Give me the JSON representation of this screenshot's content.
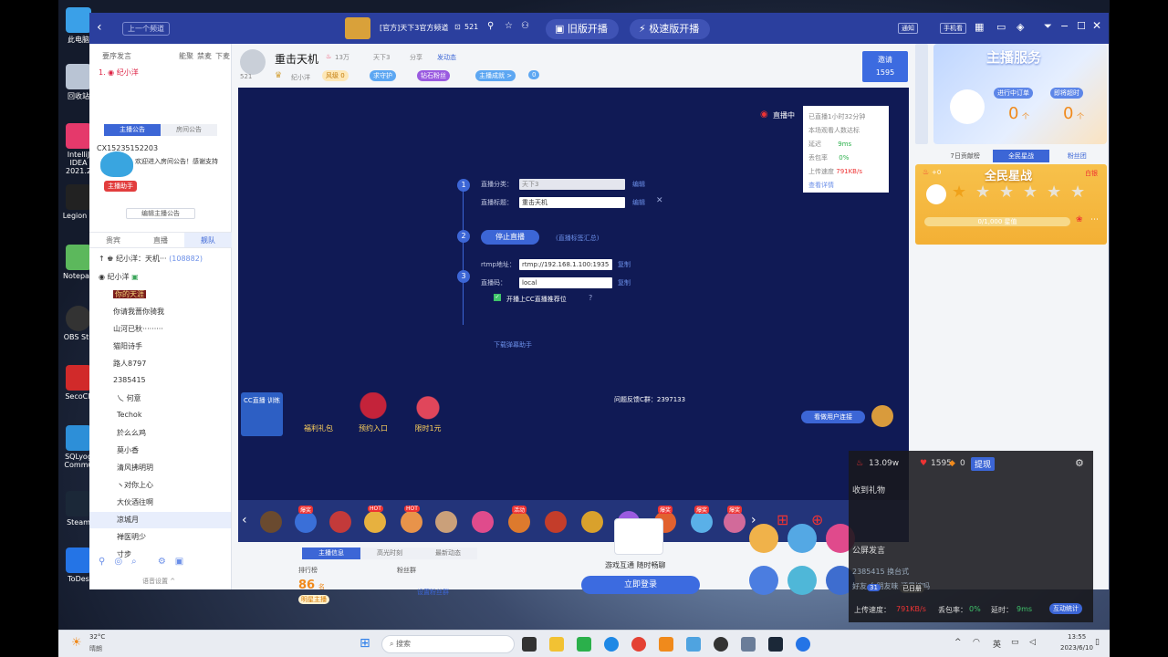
{
  "desktop": {
    "icons": [
      "此电脑",
      "回收站",
      "IntelliJ IDEA 2021.2",
      "Legion Z",
      "Notepad",
      "OBS Stu",
      "SecoCli",
      "SQLyog Commu",
      "Steam",
      "ToDes"
    ]
  },
  "titlebar": {
    "back_label": "上一个频道",
    "channel_title": "[官方]天下3官方频道",
    "viewer_count": "521",
    "old_stream_btn": "旧版开播",
    "fast_stream_btn": "极速版开播",
    "notify_btn": "通知",
    "phone_btn": "手机看"
  },
  "streamer": {
    "name": "重击天机",
    "heat": "13万",
    "game": "天下3",
    "share": "分享",
    "follow": "发动态",
    "id": "521",
    "tag_level": "风级 0",
    "tag_guard": "求守护",
    "tag_fans": "钻石粉丝",
    "tag_achievement": "主播成就 >",
    "tag_zero": "0",
    "sub_name": "纪小洋",
    "invite_label": "邀请",
    "invite_count": "1595"
  },
  "left_panel": {
    "tabs": [
      "要序发言",
      "能聚",
      "禁麦",
      "下麦"
    ],
    "user_first": "纪小洋",
    "announce_tabs": [
      "主播公告",
      "房间公告"
    ],
    "announce_id": "CX15235152203",
    "announce_text": "欢迎进入房间公告！感谢支持",
    "assistant_badge": "主播助手",
    "edit_btn": "编辑主播公告",
    "list_tabs": [
      "贵宾",
      "直播",
      "舰队"
    ],
    "top_user": "纪小洋：天机···",
    "top_user_id": "(108882)",
    "users": [
      "纪小洋",
      "你的天涯",
      "你请我蔷你骑我",
      "山河已秋·········",
      "猫阳诗手",
      "路人8797",
      "2385415",
      "乀 何意",
      "Techok",
      "於么么鸡",
      "莫小香",
      "清风拂明玥",
      "ヽ对你上心",
      "大伙酒往啊",
      "凉城月",
      "禅医明少",
      "寸步"
    ],
    "bottom_label": "语音设置 ^"
  },
  "stream_setup": {
    "live_status": "直播中",
    "stats": {
      "duration": "已直播1小时32分钟",
      "viewers": "本场观看人数达标",
      "delay_label": "延迟",
      "delay": "9ms",
      "loss_label": "丢包率",
      "loss": "0%",
      "upload_label": "上传速度",
      "upload": "791KB/s",
      "detail": "查看详情"
    },
    "category_label": "直播分类：",
    "category_value": "天下3",
    "category_edit": "编辑",
    "title_label": "直播标题：",
    "title_value": "重击天机",
    "title_edit": "编辑",
    "stop_btn": "停止直播",
    "rehearse_link": "(直播标签汇总)",
    "rtmp_label": "rtmp地址：",
    "rtmp_value": "rtmp://192.168.1.100:1935",
    "rtmp_copy": "复制",
    "key_label": "直播码：",
    "key_value": "local",
    "key_copy": "复制",
    "recommend_label": "开播上CC直播推荐位",
    "download_link": "下载弹幕助手",
    "feedback": "问题反馈C群：2397133",
    "banners": [
      "CC直播 训练",
      "福利礼包",
      "预约入口",
      "限时1元"
    ],
    "audience_btn": "看做用户连接"
  },
  "gift_bar": {
    "badges": [
      "爆奖",
      "HOT",
      "HOT",
      "活动",
      "爆奖",
      "爆奖",
      "爆奖"
    ]
  },
  "bottom_center": {
    "tabs": [
      "主播信息",
      "高光时刻",
      "最新动态"
    ],
    "rank_label": "排行榜",
    "fans_label": "粉丝群",
    "rank_value": "86",
    "rank_unit": "名",
    "rank_badge": "明星主播",
    "fans_setting": "设置粉丝群",
    "promo_text": "游戏互通 随时畅聊",
    "login_btn": "立即登录"
  },
  "right_panel": {
    "service_title": "主播服务",
    "in_progress": "进行中订单",
    "about_timeout": "即将超时",
    "count_a": "0",
    "count_b": "0",
    "unit": "个",
    "rank_tabs": [
      "7日贡献榜",
      "全民星战",
      "粉丝团"
    ],
    "war_title": "全民星战",
    "war_fire": "+0",
    "war_points": "0/1,000 星值",
    "war_tag": "白银"
  },
  "popup": {
    "hot": "13.09w",
    "fans": "1595",
    "coins": "0",
    "withdraw": "提现",
    "received_gifts": "收到礼物",
    "public_chat": "公屏发言",
    "chat_lines": [
      "2385415 换台式",
      "好友 女朋友味 还是嫁吗"
    ],
    "upload_label": "上传速度：",
    "upload": "791KB/s",
    "loss_label": "丢包率：",
    "loss": "0%",
    "delay_label": "延时：",
    "delay": "9ms",
    "interact_btn": "互动统计",
    "level": "31",
    "chip": "已日册"
  },
  "taskbar": {
    "weather_temp": "32°C",
    "weather_desc": "晴朗",
    "search_placeholder": "搜索",
    "lang": "英",
    "time": "13:55",
    "date": "2023/6/10"
  },
  "colors": {
    "title_blue": "#2b3f9e",
    "video_navy": "#101a55",
    "accent_blue": "#3c66d6",
    "gold": "#f6b73c"
  }
}
